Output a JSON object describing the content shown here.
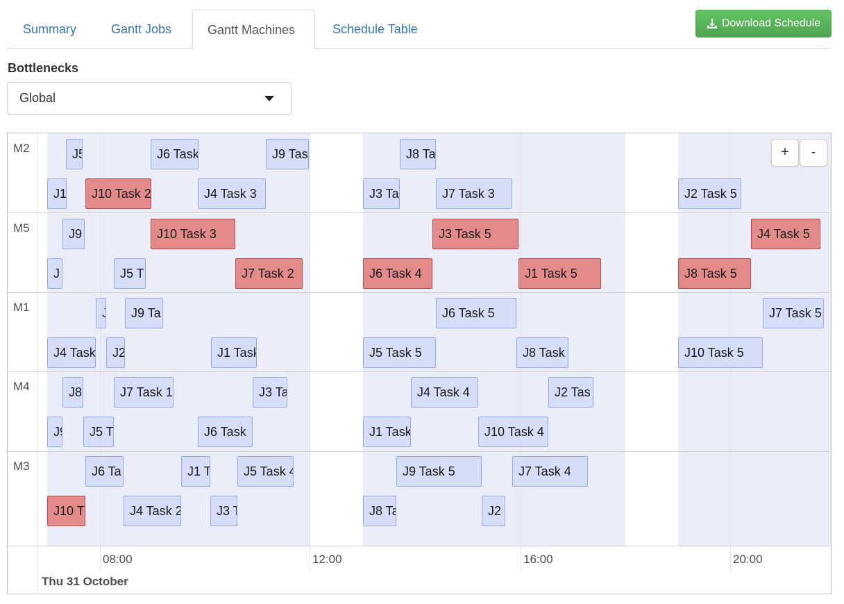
{
  "tabs": [
    "Summary",
    "Gantt Jobs",
    "Gantt Machines",
    "Schedule Table"
  ],
  "active_tab": "Gantt Machines",
  "download_label": "Download Schedule",
  "bottlenecks_label": "Bottlenecks",
  "bottleneck_selected": "Global",
  "zoom": {
    "in": "+",
    "out": "-"
  },
  "machines": [
    "M2",
    "M5",
    "M1",
    "M4",
    "M3"
  ],
  "axis_ticks": [
    "08:00",
    "12:00",
    "16:00",
    "20:00"
  ],
  "axis_date": "Thu 31 October",
  "colors": {
    "task": "#d6ddf7",
    "bottleneck": "#e38b8b",
    "accent": "#337ab7",
    "download": "#5cb85c"
  },
  "tasks": [
    {
      "label": "J5",
      "red": false
    },
    {
      "label": "J6 Task",
      "red": false
    },
    {
      "label": "J9 Tas",
      "red": false
    },
    {
      "label": "J8 Ta",
      "red": false
    },
    {
      "label": "J1",
      "red": false
    },
    {
      "label": "J10 Task 2",
      "red": true
    },
    {
      "label": "J4 Task 3",
      "red": false
    },
    {
      "label": "J3 Ta",
      "red": false
    },
    {
      "label": "J7 Task 3",
      "red": false
    },
    {
      "label": "J2 Task 5",
      "red": false
    },
    {
      "label": "J9",
      "red": false
    },
    {
      "label": "J10 Task 3",
      "red": true
    },
    {
      "label": "J3 Task 5",
      "red": true
    },
    {
      "label": "J4 Task 5",
      "red": true
    },
    {
      "label": "J",
      "red": false
    },
    {
      "label": "J5 T",
      "red": false
    },
    {
      "label": "J7 Task 2",
      "red": true
    },
    {
      "label": "J6 Task 4",
      "red": true
    },
    {
      "label": "J1 Task 5",
      "red": true
    },
    {
      "label": "J8 Task 5",
      "red": true
    },
    {
      "label": "J",
      "red": false
    },
    {
      "label": "J9 Ta",
      "red": false
    },
    {
      "label": "J6 Task 5",
      "red": false
    },
    {
      "label": "J7 Task 5",
      "red": false
    },
    {
      "label": "J4 Task",
      "red": false
    },
    {
      "label": "J2",
      "red": false
    },
    {
      "label": "J1 Task",
      "red": false
    },
    {
      "label": "J5 Task 5",
      "red": false
    },
    {
      "label": "J8 Task",
      "red": false
    },
    {
      "label": "J10 Task 5",
      "red": false
    },
    {
      "label": "J8",
      "red": false
    },
    {
      "label": "J7 Task 1",
      "red": false
    },
    {
      "label": "J3 Ta",
      "red": false
    },
    {
      "label": "J4 Task 4",
      "red": false
    },
    {
      "label": "J2 Tas",
      "red": false
    },
    {
      "label": "J9",
      "red": false
    },
    {
      "label": "J5 T",
      "red": false
    },
    {
      "label": "J6 Task",
      "red": false
    },
    {
      "label": "J1 Task",
      "red": false
    },
    {
      "label": "J10 Task 4",
      "red": false
    },
    {
      "label": "J6 Ta",
      "red": false
    },
    {
      "label": "J1 T",
      "red": false
    },
    {
      "label": "J5 Task 4",
      "red": false
    },
    {
      "label": "J9 Task 5",
      "red": false
    },
    {
      "label": "J7 Task 4",
      "red": false
    },
    {
      "label": "J10 T",
      "red": true
    },
    {
      "label": "J4 Task 2",
      "red": false
    },
    {
      "label": "J3 T",
      "red": false
    },
    {
      "label": "J8 Ta",
      "red": false
    },
    {
      "label": "J2",
      "red": false
    }
  ]
}
